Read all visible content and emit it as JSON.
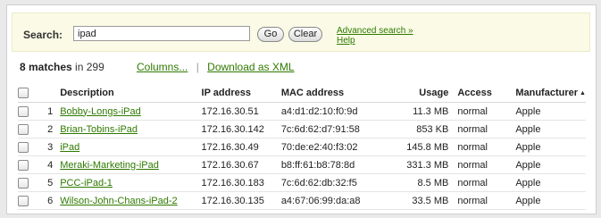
{
  "search": {
    "label": "Search:",
    "value": "ipad",
    "go_label": "Go",
    "clear_label": "Clear",
    "advanced_label": "Advanced search »",
    "help_label": "Help"
  },
  "results": {
    "count": "8 matches",
    "suffix": "in 299",
    "columns_link": "Columns...",
    "download_link": "Download as XML"
  },
  "table": {
    "headers": {
      "description": "Description",
      "ip": "IP address",
      "mac": "MAC address",
      "usage": "Usage",
      "access": "Access",
      "manufacturer": "Manufacturer"
    },
    "sort_icon": "▲",
    "rows": [
      {
        "num": "1",
        "description": "Bobby-Longs-iPad",
        "ip": "172.16.30.51",
        "mac": "a4:d1:d2:10:f0:9d",
        "usage": "11.3 MB",
        "access": "normal",
        "manufacturer": "Apple"
      },
      {
        "num": "2",
        "description": "Brian-Tobins-iPad",
        "ip": "172.16.30.142",
        "mac": "7c:6d:62:d7:91:58",
        "usage": "853 KB",
        "access": "normal",
        "manufacturer": "Apple"
      },
      {
        "num": "3",
        "description": "iPad",
        "ip": "172.16.30.49",
        "mac": "70:de:e2:40:f3:02",
        "usage": "145.8 MB",
        "access": "normal",
        "manufacturer": "Apple"
      },
      {
        "num": "4",
        "description": "Meraki-Marketing-iPad",
        "ip": "172.16.30.67",
        "mac": "b8:ff:61:b8:78:8d",
        "usage": "331.3 MB",
        "access": "normal",
        "manufacturer": "Apple"
      },
      {
        "num": "5",
        "description": "PCC-iPad-1",
        "ip": "172.16.30.183",
        "mac": "7c:6d:62:db:32:f5",
        "usage": "8.5 MB",
        "access": "normal",
        "manufacturer": "Apple"
      },
      {
        "num": "6",
        "description": "Wilson-John-Chans-iPad-2",
        "ip": "172.16.30.135",
        "mac": "a4:67:06:99:da:a8",
        "usage": "33.5 MB",
        "access": "normal",
        "manufacturer": "Apple"
      }
    ]
  }
}
